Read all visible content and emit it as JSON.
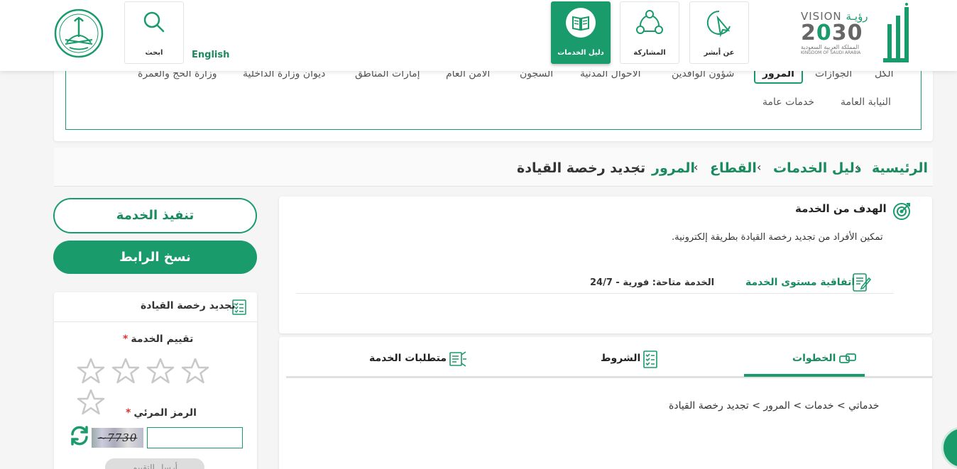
{
  "header": {
    "vision": {
      "word": "VISION",
      "ar_word": "رؤيـة",
      "year_a": "2",
      "year_b": "0",
      "year_c": "30",
      "kingdom_ar": "المملكة العربية السعودية",
      "kingdom_en": "KINGDOM OF SAUDI ARABIA"
    },
    "nav": [
      {
        "label": "عن أبشر",
        "icon": "cursor-click-icon"
      },
      {
        "label": "المشاركة",
        "icon": "share-nodes-icon"
      },
      {
        "label": "دليل الخدمات",
        "icon": "book-icon"
      },
      {
        "label": "ابحث",
        "icon": "search-icon"
      }
    ],
    "language_link": "English"
  },
  "categories": [
    "الكل",
    "الجوازات",
    "المرور",
    "شؤون الوافدين",
    "الاحوال المدنية",
    "السجون",
    "الامن العام",
    "إمارات المناطق",
    "ديوان وزارة الداخلية",
    "وزارة الحج والعمرة",
    "النيابة العامة",
    "خدمات عامة"
  ],
  "breadcrumb": [
    "الرئيسية",
    "دليل الخدمات",
    "القطاع",
    "المرور",
    "تجديد رخصة القيادة"
  ],
  "goal": {
    "title": "الهدف من الخدمة",
    "description": "تمكين الأفراد من تجديد رخصة القيادة بطريقة إلكترونية.",
    "sla_label": "اتفاقية مستوى الخدمة",
    "availability": "الخدمة متاحة: فورية - 24/7"
  },
  "tabs": {
    "items": [
      "الخطوات",
      "الشروط",
      "متطلبات الخدمة"
    ],
    "steps_path": "خدماتي > خدمات > المرور > تجديد رخصة القيادة"
  },
  "actions": {
    "execute": "تنفيذ الخدمة",
    "copy_link": "نسخ الرابط"
  },
  "rating": {
    "title": "تجديد رخصة القيادة",
    "rate_label": "تقييم الخدمة",
    "captcha_label": "الرمز المرئي",
    "required_mark": "*",
    "captcha_text": "~7730",
    "send": "أرسل التقييم",
    "stars": 5,
    "value": 0
  },
  "colors": {
    "brand": "#1a9b6c",
    "text": "#222222"
  }
}
